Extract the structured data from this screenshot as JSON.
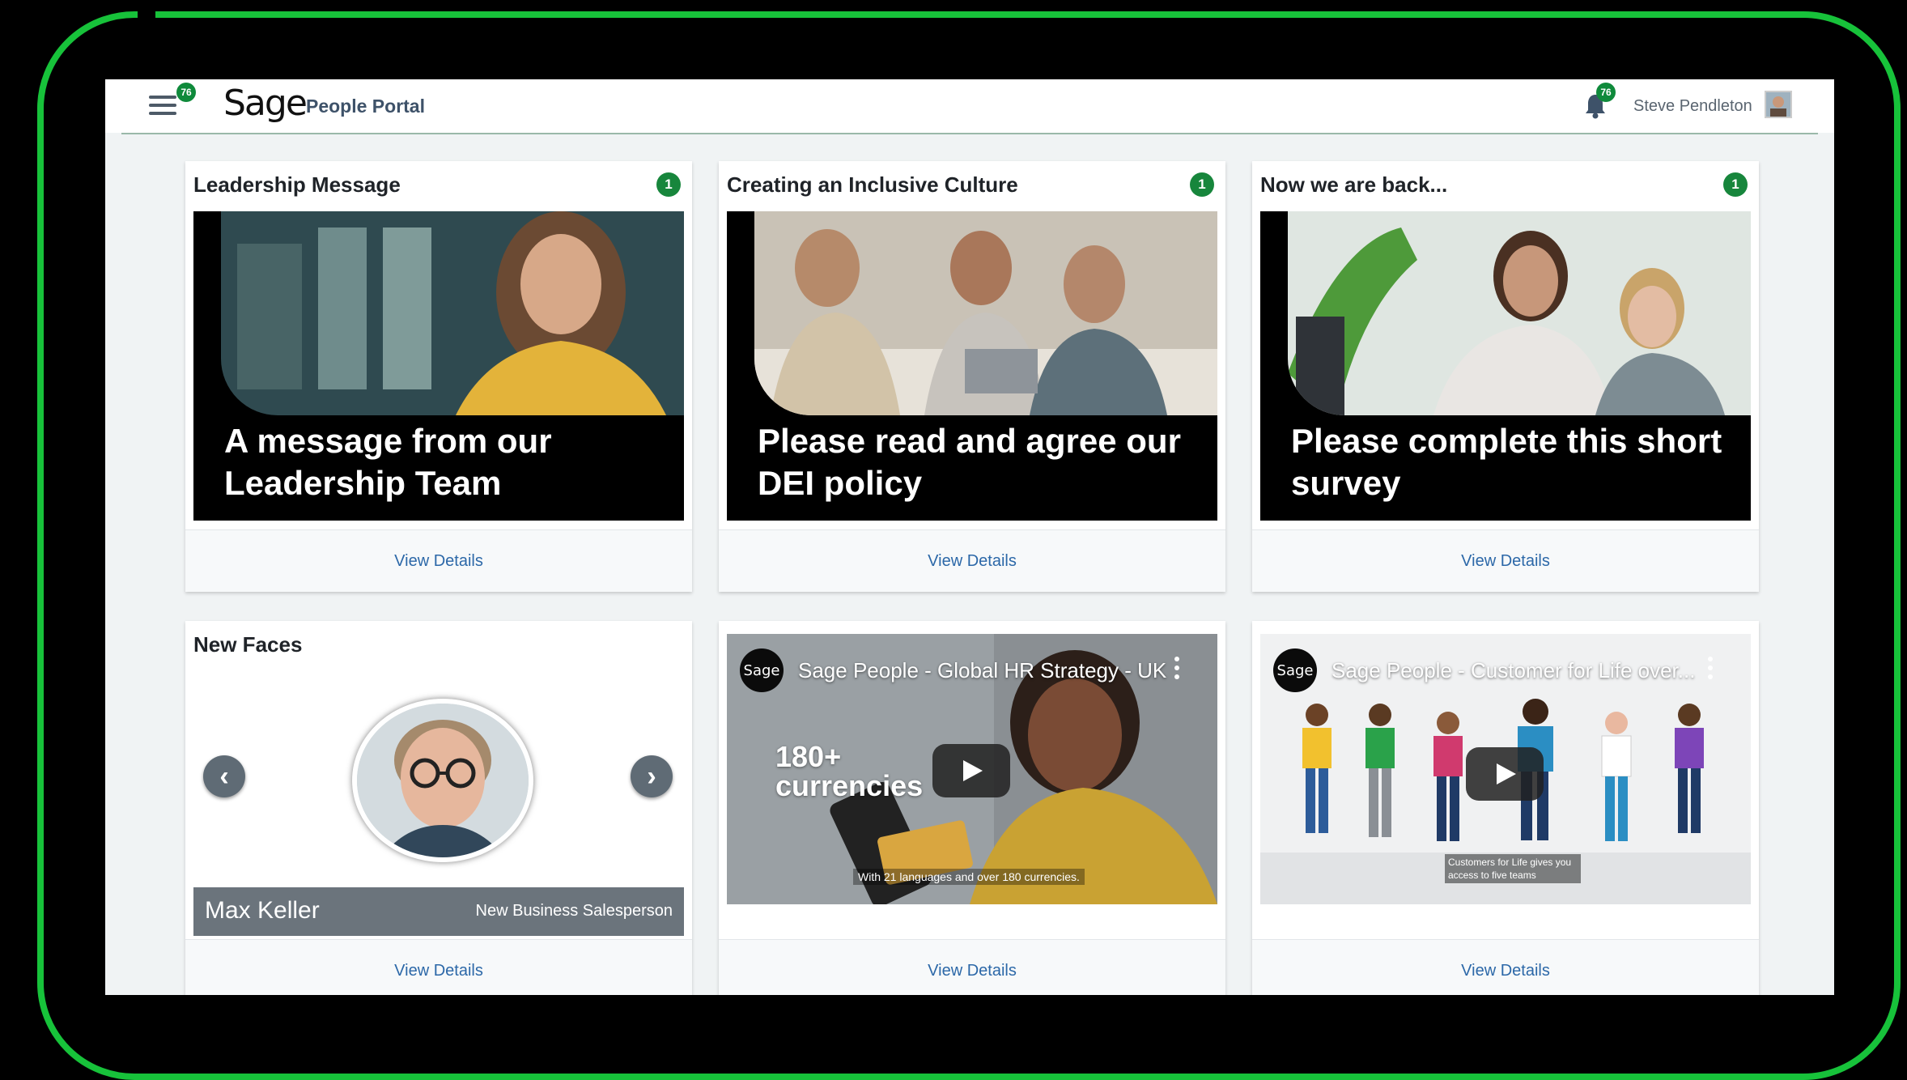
{
  "header": {
    "menu_badge": "76",
    "logo": "Sage",
    "portal_name": "People Portal",
    "notification_badge": "76",
    "user_name": "Steve Pendleton"
  },
  "cards": [
    {
      "title": "Leadership Message",
      "badge": "1",
      "banner_text": "A message from our Leadership Team",
      "action": "View Details"
    },
    {
      "title": "Creating an Inclusive Culture",
      "badge": "1",
      "banner_text": "Please read and agree our DEI policy",
      "action": "View Details"
    },
    {
      "title": "Now we are back...",
      "badge": "1",
      "banner_text": "Please complete this short survey",
      "action": "View Details"
    }
  ],
  "new_faces": {
    "title": "New Faces",
    "name": "Max Keller",
    "role": "New Business Salesperson",
    "prev_glyph": "‹",
    "next_glyph": "›",
    "action": "View Details"
  },
  "videos": [
    {
      "channel_logo": "Sage",
      "title": "Sage People - Global HR Strategy - UK",
      "overlay_big": "180+ currencies",
      "caption": "With 21 languages and over 180 currencies.",
      "action": "View Details"
    },
    {
      "channel_logo": "Sage",
      "title": "Sage People - Customer for Life over...",
      "caption": "Customers for Life gives you access to five teams",
      "action": "View Details"
    }
  ],
  "colors": {
    "frame": "#17c23a",
    "badge": "#17863c",
    "link": "#2c68a8",
    "portal_title": "#3e5269"
  },
  "icons": [
    "hamburger-icon",
    "bell-icon",
    "play-icon",
    "kebab-menu-icon",
    "chevron-left-icon",
    "chevron-right-icon"
  ]
}
